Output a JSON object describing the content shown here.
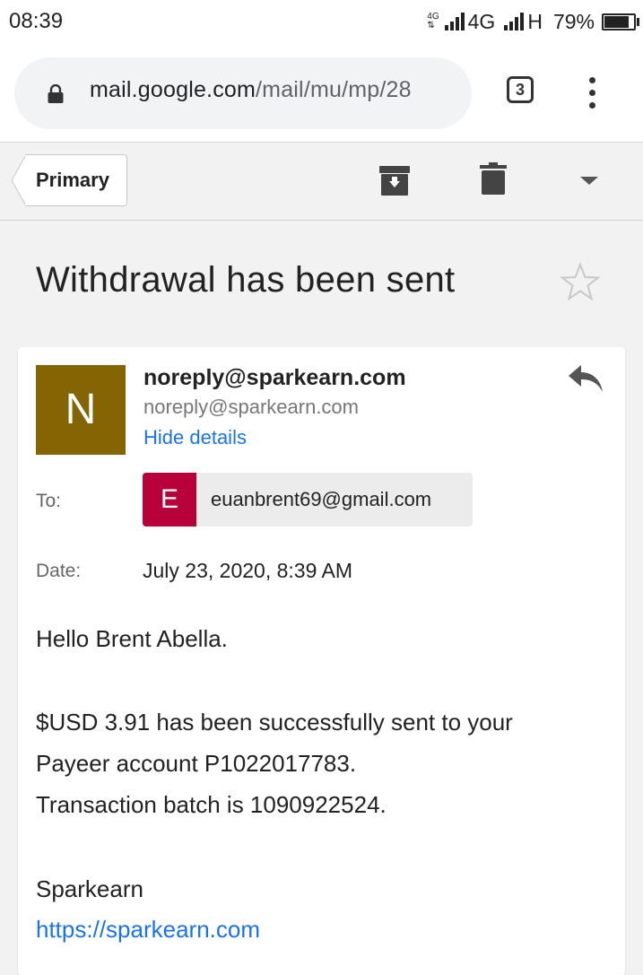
{
  "status_bar": {
    "time": "08:39",
    "net_small": "4G",
    "net1": "4G",
    "net2": "H",
    "battery": "79%"
  },
  "browser": {
    "url_host": "mail.google.com",
    "url_path": "/mail/mu/mp/28",
    "tab_count": "3"
  },
  "toolbar": {
    "primary_label": "Primary"
  },
  "email": {
    "subject": "Withdrawal has been sent",
    "sender_initial": "N",
    "sender_name": "noreply@sparkearn.com",
    "sender_email": "noreply@sparkearn.com",
    "hide_details": "Hide details",
    "to_label": "To:",
    "recipient_initial": "E",
    "recipient_email": "euanbrent69@gmail.com",
    "date_label": "Date:",
    "date_value": "July 23, 2020, 8:39 AM",
    "greeting": "Hello Brent Abella.",
    "line1": "$USD 3.91 has been successfully sent to your",
    "line2": "Payeer account P1022017783.",
    "line3": "Transaction batch is 1090922524.",
    "signature": "Sparkearn",
    "link": "https://sparkearn.com"
  },
  "colors": {
    "sender_avatar": "#856404",
    "recipient_avatar": "#b8003a",
    "link": "#1a73e8"
  }
}
